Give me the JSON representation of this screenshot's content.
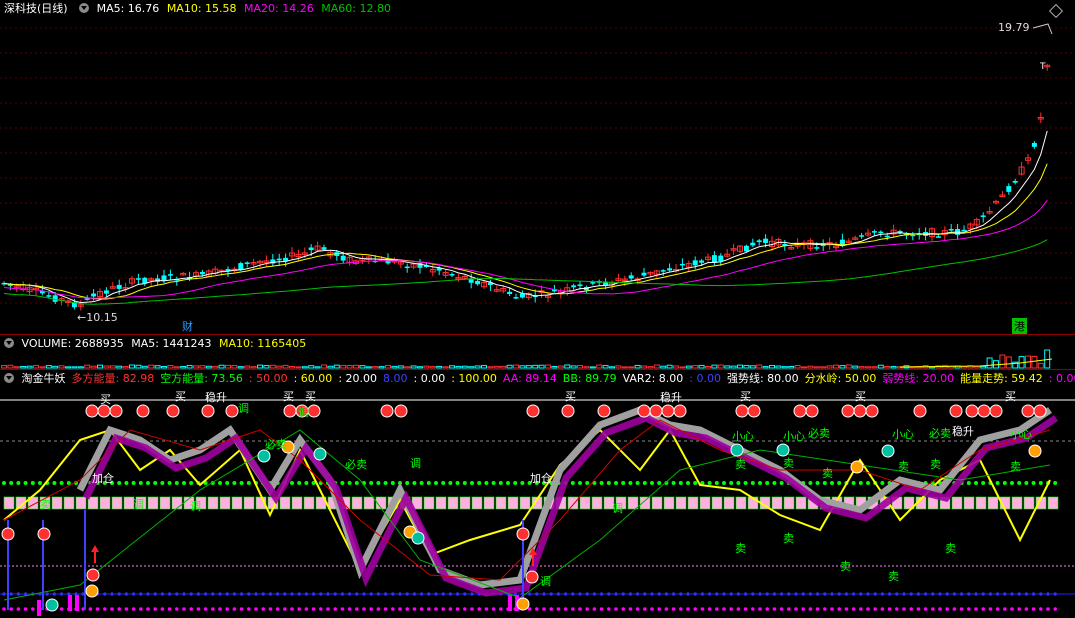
{
  "price_pane": {
    "title": "深科技(日线)",
    "ma": [
      {
        "label": "MA5: 16.76",
        "color": "#ffffff"
      },
      {
        "label": "MA10: 15.58",
        "color": "#ffff00"
      },
      {
        "label": "MA20: 14.26",
        "color": "#ff00ff"
      },
      {
        "label": "MA60: 12.80",
        "color": "#00c000"
      }
    ],
    "high_label": "19.79",
    "low_label": "←10.15",
    "event_marks": [
      "财",
      "港"
    ],
    "t_label": "T"
  },
  "volume_pane": {
    "items": [
      {
        "label": "VOLUME: 2688935",
        "color": "#ffffff"
      },
      {
        "label": "MA5: 1441243",
        "color": "#ffffff"
      },
      {
        "label": "MA10: 1165405",
        "color": "#ffff00"
      }
    ]
  },
  "indicator_pane": {
    "items": [
      {
        "label": "淘金牛妖",
        "color": "#ffffff"
      },
      {
        "label": "多方能量: 82.98",
        "color": "#ff3030"
      },
      {
        "label": "空方能量: 73.56",
        "color": "#00ff00"
      },
      {
        "label": ": 50.00",
        "color": "#ff3030"
      },
      {
        "label": ": 60.00",
        "color": "#ffff00"
      },
      {
        "label": ": 20.00",
        "color": "#ffffff"
      },
      {
        "label": "8.00",
        "color": "#4040ff"
      },
      {
        "label": ": 0.00",
        "color": "#ffffff"
      },
      {
        "label": ": 100.00",
        "color": "#ffff00"
      },
      {
        "label": "AA: 89.14",
        "color": "#ff00ff"
      },
      {
        "label": "BB: 89.79",
        "color": "#00ff00"
      },
      {
        "label": "VAR2: 8.00",
        "color": "#ffffff"
      },
      {
        "label": ": 0.00",
        "color": "#4040ff"
      },
      {
        "label": "强势线: 80.00",
        "color": "#ffffff"
      },
      {
        "label": "分水岭: 50.00",
        "color": "#ffff00"
      },
      {
        "label": "弱势线: 20.00",
        "color": "#ff00ff"
      },
      {
        "label": "能量走势: 59.42",
        "color": "#ffff00"
      },
      {
        "label": ": 0.00",
        "color": "#ff00ff"
      }
    ],
    "signal_texts": {
      "buy": "买",
      "stable": "稳升",
      "add": "加仓",
      "sell": "卖",
      "adjust": "调",
      "must_sell": "必卖",
      "careful": "小心"
    }
  },
  "colors": {
    "background": "#000000",
    "up": "#ff3030",
    "down": "#00ffff",
    "ma5": "#ffffff",
    "ma10": "#ffff00",
    "ma20": "#ff00ff",
    "ma60": "#00c000",
    "separator": "#8b0000"
  }
}
